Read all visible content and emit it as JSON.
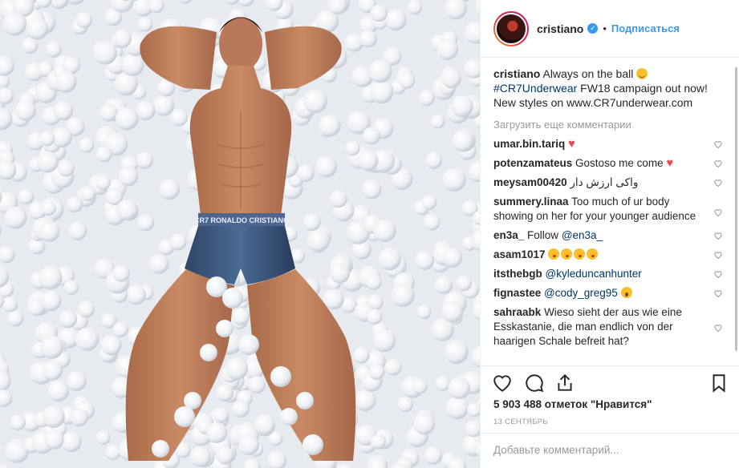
{
  "header": {
    "username": "cristiano",
    "separator": "•",
    "follow_label": "Подписаться"
  },
  "caption": {
    "username": "cristiano",
    "text": "Always on the ball",
    "hashtag": "#CR7Underwear",
    "rest": "FW18 campaign out now! New styles on www.CR7underwear.com"
  },
  "load_more_label": "Загрузить еще комментарии",
  "comments": [
    {
      "user": "umar.bin.tariq",
      "text": ""
    },
    {
      "user": "potenzamateus",
      "text": "Gostoso me come"
    },
    {
      "user": "meysam00420",
      "text": "واکی ارزش دار"
    },
    {
      "user": "summery.linaa",
      "text": "Too much of ur body showing on her for your younger audience"
    },
    {
      "user": "en3a_",
      "text": "Follow",
      "mention": "@en3a_"
    },
    {
      "user": "asam1017",
      "text": ""
    },
    {
      "user": "itsthebgb",
      "text": "",
      "mention": "@kyleduncanhunter"
    },
    {
      "user": "fignastee",
      "text": "",
      "mention": "@cody_greg95"
    },
    {
      "user": "sahraabk",
      "text": "Wieso sieht der aus wie eine Esskastanie, die man endlich von der haarigen Schale befreit hat?"
    }
  ],
  "likes_text": "5 903 488 отметок \"Нравится\"",
  "date_text": "13 СЕНТЯБРЬ",
  "add_comment": {
    "placeholder": "Добавьте комментарий..."
  },
  "colors": {
    "link": "#3897f0",
    "hashtag": "#003569",
    "heart": "#ed4956"
  }
}
